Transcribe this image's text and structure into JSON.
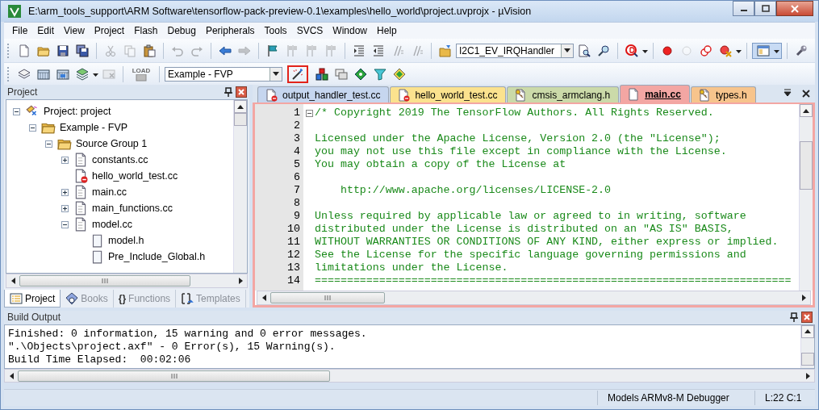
{
  "window": {
    "title": "E:\\arm_tools_support\\ARM Software\\tensorflow-pack-preview-0.1\\examples\\hello_world\\project.uvprojx - µVision"
  },
  "menu": [
    {
      "label": "File"
    },
    {
      "label": "Edit"
    },
    {
      "label": "View"
    },
    {
      "label": "Project"
    },
    {
      "label": "Flash"
    },
    {
      "label": "Debug"
    },
    {
      "label": "Peripherals"
    },
    {
      "label": "Tools"
    },
    {
      "label": "SVCS"
    },
    {
      "label": "Window"
    },
    {
      "label": "Help"
    }
  ],
  "toolbar_1": {
    "buttons": [
      {
        "disabled": false
      },
      {
        "disabled": false
      },
      {
        "disabled": false
      },
      {
        "disabled": false
      },
      {
        "disabled": true
      },
      {
        "disabled": true
      },
      {
        "disabled": false
      },
      {
        "disabled": true
      },
      {
        "disabled": true
      },
      {
        "disabled": false
      },
      {
        "disabled": true
      },
      {
        "disabled": false
      },
      {
        "disabled": true
      },
      {
        "disabled": true
      },
      {
        "disabled": true
      },
      {
        "disabled": false
      },
      {
        "disabled": false
      },
      {
        "disabled": true
      },
      {
        "disabled": true
      },
      {
        "disabled": false
      }
    ],
    "find_combo": {
      "value": "I2C1_EV_IRQHandler"
    },
    "buttons_2": [
      {
        "disabled": false
      },
      {
        "disabled": false
      },
      {
        "disabled": false
      },
      {
        "disabled": false
      },
      {
        "disabled": true
      },
      {
        "disabled": false
      },
      {
        "disabled": false
      },
      {
        "disabled": false
      },
      {
        "disabled": false
      }
    ]
  },
  "toolbar_2": {
    "buttons": [
      {
        "disabled": false
      },
      {
        "disabled": false
      },
      {
        "disabled": false
      },
      {
        "disabled": false
      },
      {
        "disabled": true
      }
    ],
    "load_button": {
      "label": "LOAD",
      "disabled": true
    },
    "target_combo": {
      "value": "Example - FVP"
    },
    "buttons_2": [
      {
        "highlighted": true
      },
      {
        "highlighted": false
      },
      {
        "highlighted": false
      },
      {
        "highlighted": false
      },
      {
        "highlighted": false
      },
      {
        "highlighted": false
      }
    ]
  },
  "project_panel": {
    "title": "Project",
    "tree": [
      {
        "label": "Project: project",
        "kind": "project",
        "expanded": true,
        "children": [
          {
            "label": "Example - FVP",
            "kind": "target",
            "expanded": true,
            "children": [
              {
                "label": "Source Group 1",
                "kind": "group",
                "expanded": true,
                "children": [
                  {
                    "label": "constants.cc",
                    "kind": "source",
                    "expanded": false
                  },
                  {
                    "label": "hello_world_test.cc",
                    "kind": "excluded"
                  },
                  {
                    "label": "main.cc",
                    "kind": "source",
                    "expanded": false
                  },
                  {
                    "label": "main_functions.cc",
                    "kind": "source",
                    "expanded": false
                  },
                  {
                    "label": "model.cc",
                    "kind": "source",
                    "expanded": true,
                    "children": [
                      {
                        "label": "model.h",
                        "kind": "header"
                      },
                      {
                        "label": "Pre_Include_Global.h",
                        "kind": "header"
                      }
                    ]
                  }
                ]
              }
            ]
          }
        ]
      }
    ],
    "tabs": [
      {
        "label": "Project",
        "selected": true,
        "kind": "project"
      },
      {
        "label": "Books",
        "selected": false,
        "kind": "books"
      },
      {
        "label": "Functions",
        "selected": false,
        "glyph": "{}"
      },
      {
        "label": "Templates",
        "selected": false,
        "kind": "templates"
      }
    ]
  },
  "editor": {
    "tabs": [
      {
        "label": "output_handler_test.cc",
        "selected": false,
        "kind": "excluded",
        "color": "#c6d6ef"
      },
      {
        "label": "hello_world_test.cc",
        "selected": false,
        "kind": "excluded",
        "color": "#fbe28e"
      },
      {
        "label": "cmsis_armclang.h",
        "selected": false,
        "kind": "readonly",
        "color": "#cbdaa9"
      },
      {
        "label": "main.cc",
        "selected": true,
        "kind": "source",
        "color": "#f3a6a3"
      },
      {
        "label": "types.h",
        "selected": false,
        "kind": "readonly",
        "color": "#f7c48c"
      }
    ],
    "lines": [
      {
        "number": "1",
        "text": "/* Copyright 2019 The TensorFlow Authors. All Rights Reserved.",
        "fold": true
      },
      {
        "number": "2"
      },
      {
        "number": "3",
        "text": "Licensed under the Apache License, Version 2.0 (the \"License\");"
      },
      {
        "number": "4",
        "text": "you may not use this file except in compliance with the License."
      },
      {
        "number": "5",
        "text": "You may obtain a copy of the License at"
      },
      {
        "number": "6"
      },
      {
        "number": "7",
        "text": "    http://www.apache.org/licenses/LICENSE-2.0"
      },
      {
        "number": "8"
      },
      {
        "number": "9",
        "text": "Unless required by applicable law or agreed to in writing, software"
      },
      {
        "number": "10",
        "text": "distributed under the License is distributed on an \"AS IS\" BASIS,"
      },
      {
        "number": "11",
        "text": "WITHOUT WARRANTIES OR CONDITIONS OF ANY KIND, either express or implied."
      },
      {
        "number": "12",
        "text": "See the License for the specific language governing permissions and"
      },
      {
        "number": "13",
        "text": "limitations under the License."
      },
      {
        "number": "14",
        "text": "=========================================================================="
      }
    ]
  },
  "build_output": {
    "title": "Build Output",
    "lines": [
      "Finished: 0 information, 15 warning and 0 error messages.",
      "\".\\Objects\\project.axf\" - 0 Error(s), 15 Warning(s).",
      "Build Time Elapsed:  00:02:06"
    ]
  },
  "status_bar": {
    "debugger": "Models ARMv8-M Debugger",
    "position": "L:22 C:1"
  }
}
